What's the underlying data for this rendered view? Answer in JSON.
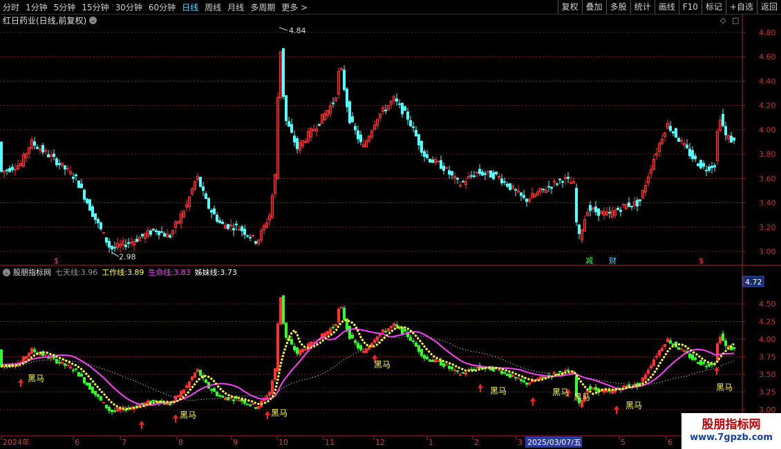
{
  "toolbar": {
    "periods": [
      "分时",
      "1分钟",
      "5分钟",
      "15分钟",
      "30分钟",
      "60分钟",
      "日线",
      "周线",
      "月线",
      "多周期",
      "更多 >"
    ],
    "active_period": "日线",
    "buttons": [
      "复权",
      "叠加",
      "多股",
      "统计",
      "画线",
      "F10",
      "标记",
      "+自选",
      "返回"
    ]
  },
  "stock_title": "红日药业(日线,前复权)",
  "pane_controls": {
    "diamond": "◇",
    "square": "□"
  },
  "main_axis_ticks": [
    "4.80",
    "4.60",
    "4.40",
    "4.20",
    "4.00",
    "3.80",
    "3.60",
    "3.40",
    "3.20",
    "3.00"
  ],
  "annotations": {
    "high_label": "4.84",
    "low_label": "2.98",
    "events": [
      "$",
      "减",
      "财",
      "$"
    ]
  },
  "indicator": {
    "name": "股朋指标网",
    "lines": [
      {
        "label": "七天线:",
        "value": "3.96",
        "color": "#9a9a9a"
      },
      {
        "label": "工作线:",
        "value": "3.89",
        "color": "#ffff3c"
      },
      {
        "label": "生命线:",
        "value": "3.83",
        "color": "#ff40ff"
      },
      {
        "label": "姊妹线:",
        "value": "3.73",
        "color": "#ffffff"
      }
    ],
    "current_value": "4.72",
    "axis_ticks": [
      "4.50",
      "4.25",
      "4.00",
      "3.75",
      "3.50",
      "3.25",
      "3.00"
    ],
    "signal_label": "黑马"
  },
  "date_axis": {
    "labels": [
      "2024年",
      "6",
      "7",
      "8",
      "9",
      "10",
      "11",
      "12",
      "1",
      "2",
      "3",
      "2025/03/07/五",
      "5",
      "6"
    ]
  },
  "watermark": {
    "title": "股朋指标网",
    "url": "www.7gpzb.com"
  },
  "colors": {
    "up": "#ff3232",
    "down": "#54ffff",
    "ind_up": "#ff3232",
    "ind_down": "#32ff32",
    "grid": "#7a1a1a",
    "axis": "#b22222"
  }
}
